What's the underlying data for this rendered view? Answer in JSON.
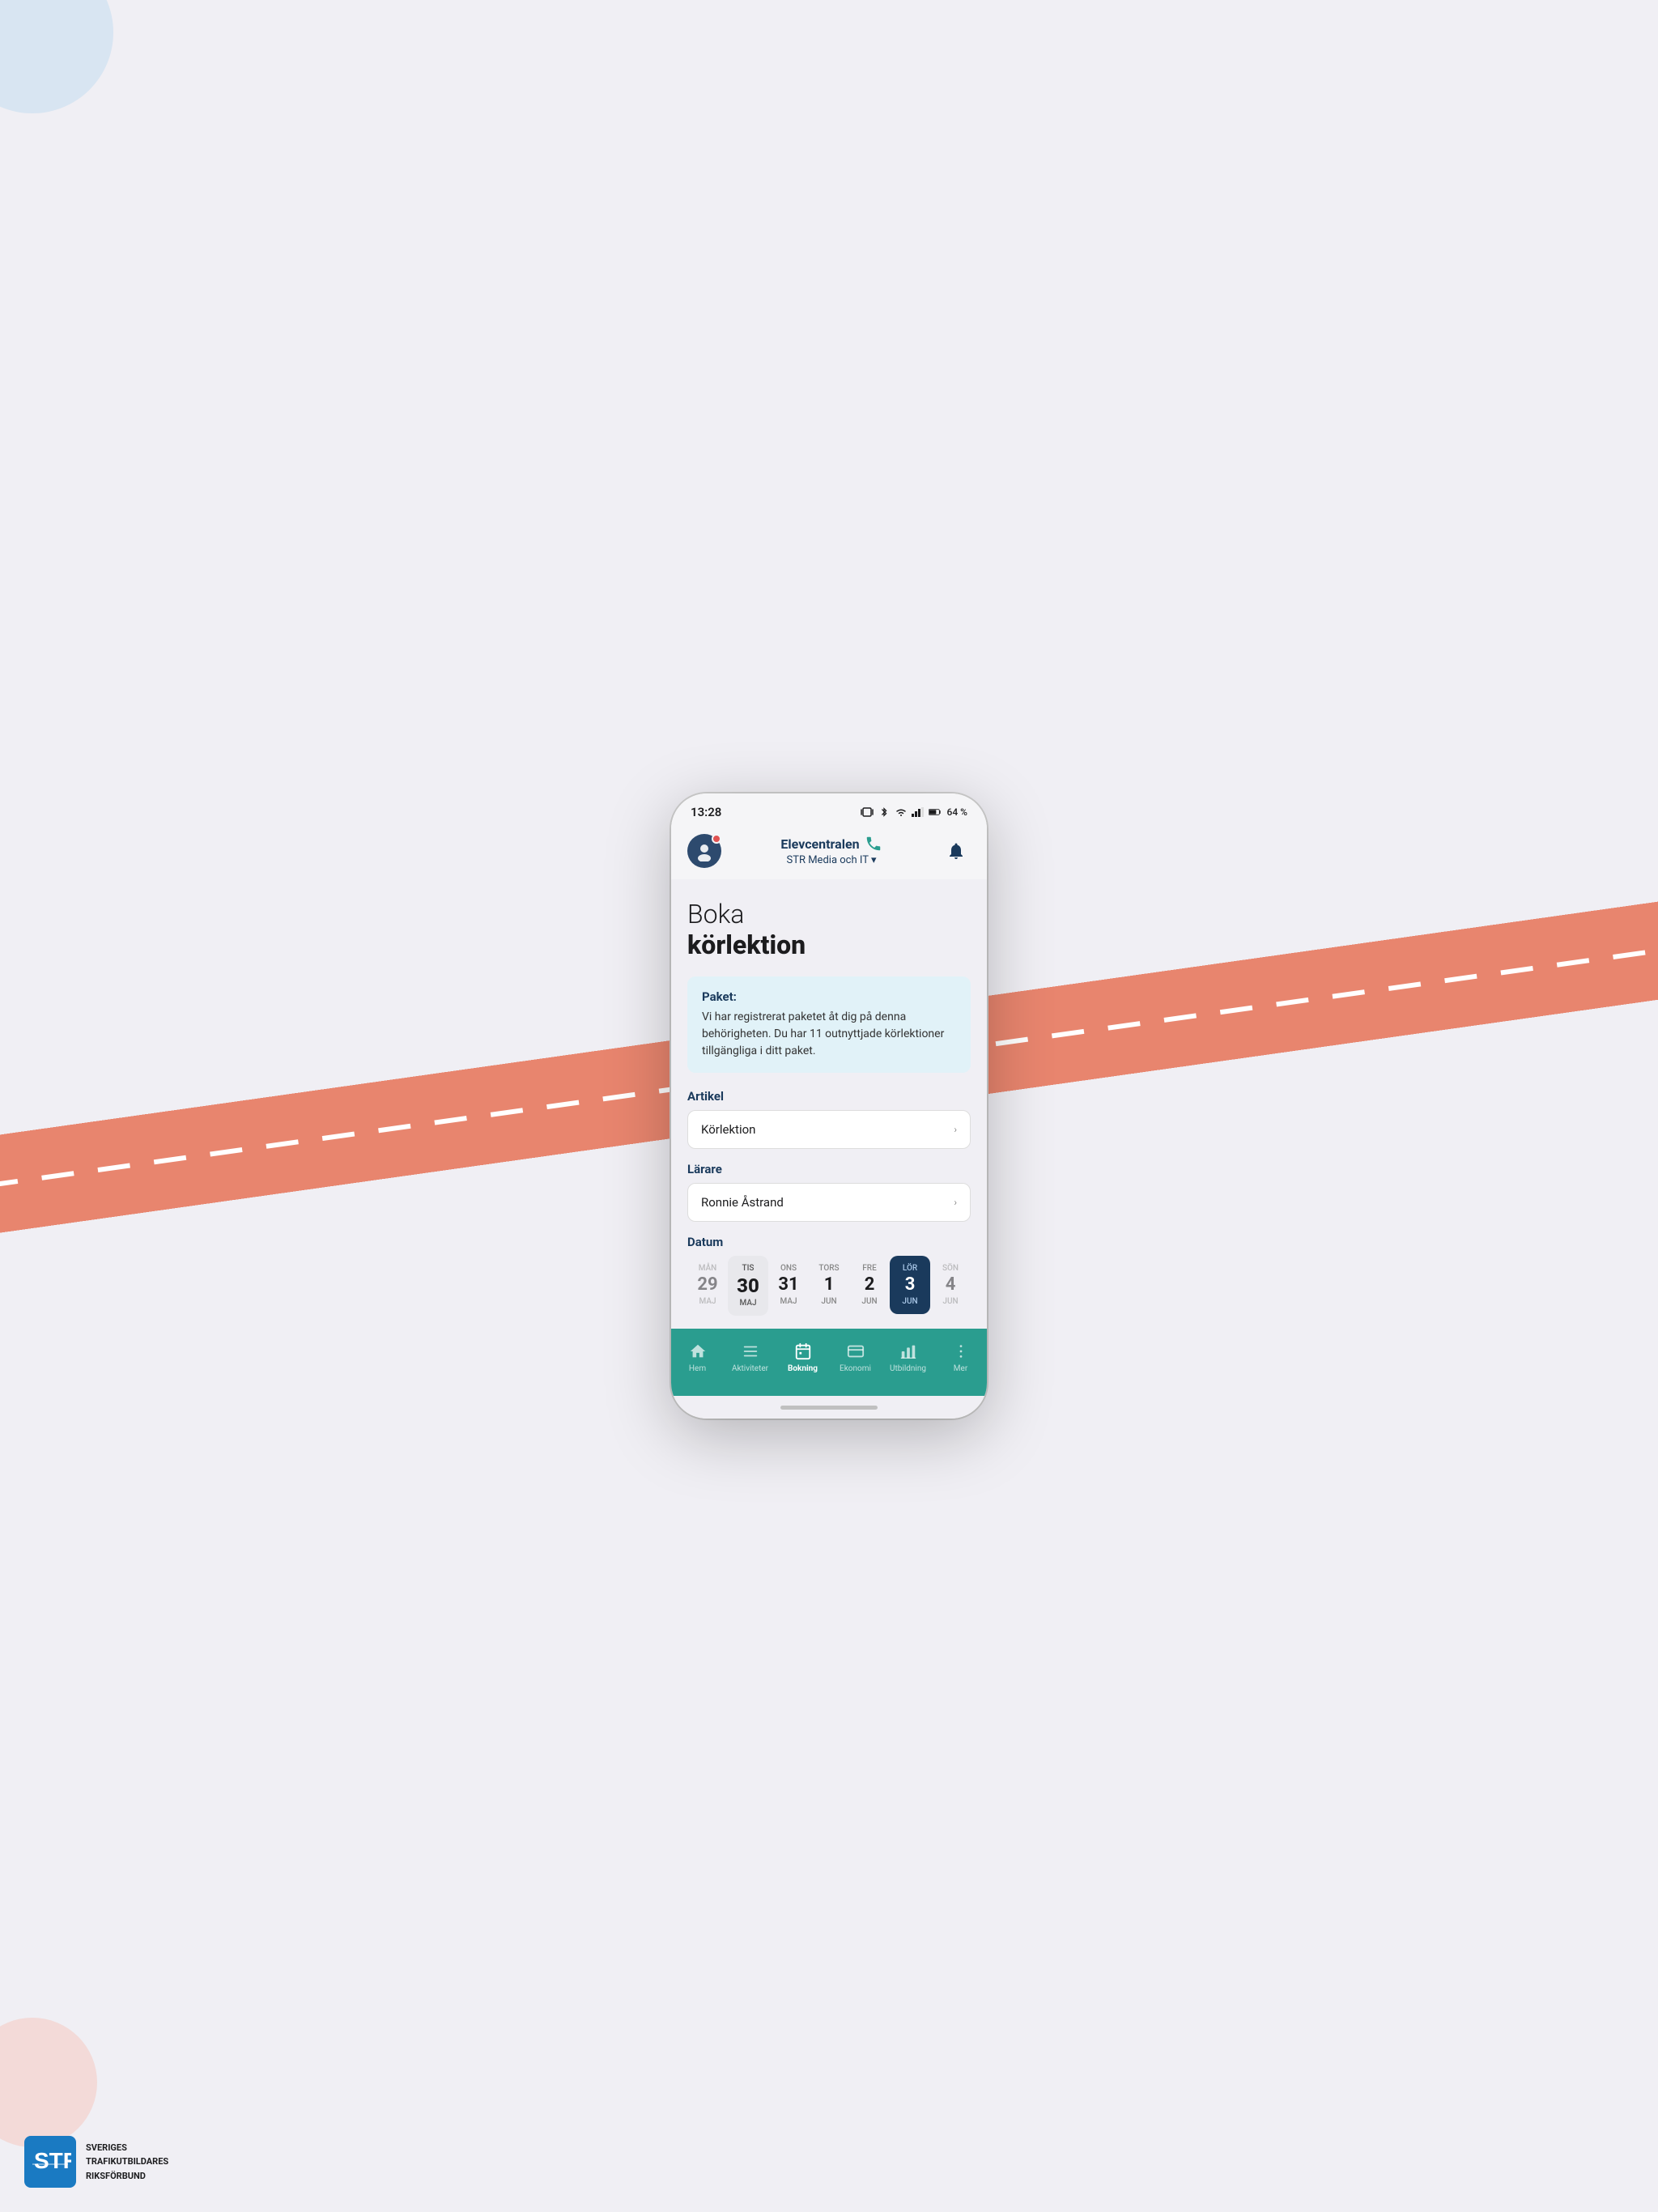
{
  "background": {
    "road_color": "#e8856e",
    "circle_top_color": "#c8ddf0",
    "circle_bottom_color": "#f5c5bb"
  },
  "status_bar": {
    "time": "13:28",
    "battery": "64 %"
  },
  "header": {
    "brand": "Elevcentralen",
    "subtitle": "STR Media och IT",
    "chevron": "▾"
  },
  "page": {
    "title_line1": "Boka",
    "title_line2": "körlektion"
  },
  "info_box": {
    "label": "Paket:",
    "text": "Vi har registrerat paketet åt dig på denna behörigheten. Du har 11 outnyttjade körlektioner tillgängliga i ditt paket."
  },
  "form": {
    "artikel_label": "Artikel",
    "artikel_value": "Körlektion",
    "larare_label": "Lärare",
    "larare_value": "Ronnie Åstrand",
    "datum_label": "Datum"
  },
  "calendar": {
    "days": [
      {
        "day_name": "MÅN",
        "number": "29",
        "month": "MAJ",
        "state": "edge"
      },
      {
        "day_name": "TIS",
        "number": "30",
        "month": "MAJ",
        "state": "highlighted"
      },
      {
        "day_name": "ONS",
        "number": "31",
        "month": "MAJ",
        "state": "normal"
      },
      {
        "day_name": "TORS",
        "number": "1",
        "month": "JUN",
        "state": "normal"
      },
      {
        "day_name": "FRE",
        "number": "2",
        "month": "JUN",
        "state": "normal"
      },
      {
        "day_name": "LÖR",
        "number": "3",
        "month": "JUN",
        "state": "active"
      },
      {
        "day_name": "SÖN",
        "number": "4",
        "month": "JUN",
        "state": "edge"
      }
    ]
  },
  "bottom_nav": {
    "items": [
      {
        "label": "Hem",
        "icon": "home"
      },
      {
        "label": "Aktiviteter",
        "icon": "list"
      },
      {
        "label": "Bokning",
        "icon": "calendar",
        "active": true
      },
      {
        "label": "Ekonomi",
        "icon": "card"
      },
      {
        "label": "Utbildning",
        "icon": "chart"
      },
      {
        "label": "Mer",
        "icon": "dots"
      }
    ]
  },
  "str_logo": {
    "abbreviation": "STR",
    "line1": "SVERIGES",
    "line2": "TRAFIKUTBILDARES",
    "line3": "RIKSFÖRBUND"
  }
}
